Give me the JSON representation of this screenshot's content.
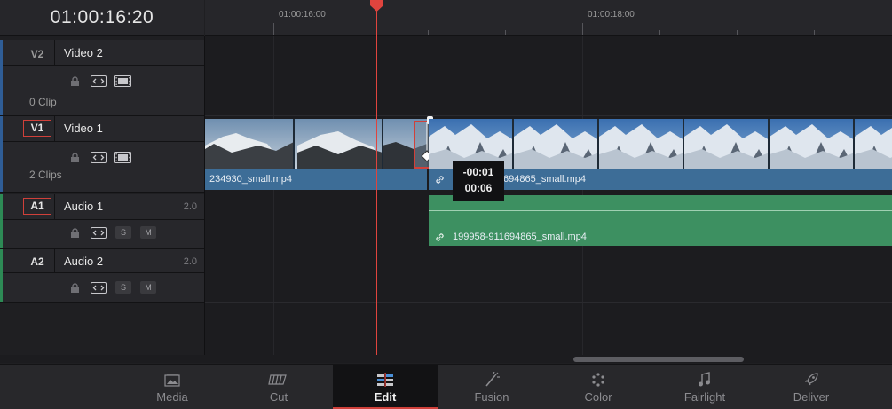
{
  "header": {
    "timecode": "01:00:16:20"
  },
  "ruler": {
    "labels": [
      "01:00:16:00",
      "01:00:18:00"
    ]
  },
  "tracks": [
    {
      "code": "V2",
      "name": "Video 2",
      "clips": "0 Clip",
      "active": false
    },
    {
      "code": "V1",
      "name": "Video 1",
      "clips": "2 Clips",
      "active": true
    },
    {
      "code": "A1",
      "name": "Audio 1",
      "volume": "2.0",
      "active": true,
      "solo": "S",
      "mute": "M"
    },
    {
      "code": "A2",
      "name": "Audio 2",
      "volume": "2.0",
      "active": false,
      "solo": "S",
      "mute": "M"
    }
  ],
  "clips": {
    "video_clip_1": "234930_small.mp4",
    "video_clip_2": "199958-911694865_small.mp4",
    "video_clip_2_visible": "694865_small.mp4",
    "audio_clip_1": "199958-911694865_small.mp4"
  },
  "tooltip": {
    "offset": "-00:01",
    "duration": "00:06"
  },
  "nav": {
    "items": [
      {
        "label": "Media",
        "icon": "media-icon"
      },
      {
        "label": "Cut",
        "icon": "cut-icon"
      },
      {
        "label": "Edit",
        "icon": "edit-icon",
        "active": true
      },
      {
        "label": "Fusion",
        "icon": "fusion-icon"
      },
      {
        "label": "Color",
        "icon": "color-icon"
      },
      {
        "label": "Fairlight",
        "icon": "fairlight-icon"
      },
      {
        "label": "Deliver",
        "icon": "deliver-icon"
      }
    ]
  },
  "colors": {
    "video_track": "#3d6d97",
    "audio_track": "#3d9061",
    "playhead": "#e0443e",
    "active_outline": "#d0403a"
  }
}
